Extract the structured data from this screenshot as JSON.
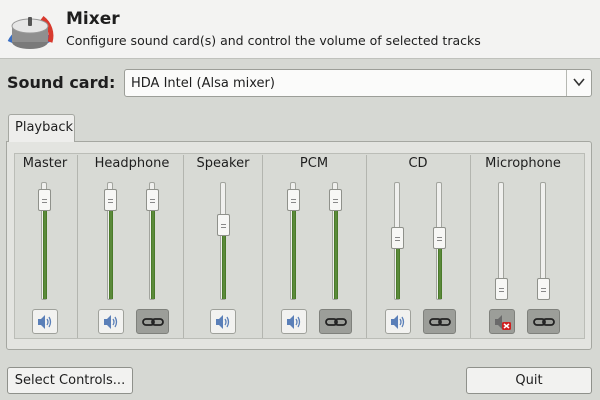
{
  "header": {
    "title": "Mixer",
    "subtitle": "Configure sound card(s) and control the volume of selected tracks"
  },
  "sound_card": {
    "label": "Sound card:",
    "selected": "HDA Intel (Alsa mixer)"
  },
  "tabs": [
    {
      "label": "Playback"
    }
  ],
  "groups": [
    {
      "label": "Master",
      "sliders": [
        0.93
      ],
      "buttons": [
        "speaker-icon"
      ]
    },
    {
      "label": "Headphone",
      "sliders": [
        0.93,
        0.93
      ],
      "buttons": [
        "speaker-icon",
        "link-icon"
      ]
    },
    {
      "label": "Speaker",
      "sliders": [
        0.67
      ],
      "buttons": [
        "speaker-icon"
      ]
    },
    {
      "label": "PCM",
      "sliders": [
        0.93,
        0.93
      ],
      "buttons": [
        "speaker-icon",
        "link-icon"
      ]
    },
    {
      "label": "CD",
      "sliders": [
        0.53,
        0.53
      ],
      "buttons": [
        "speaker-icon",
        "link-icon"
      ]
    },
    {
      "label": "Microphone",
      "sliders": [
        0.0,
        0.0
      ],
      "buttons": [
        "speaker-muted-icon",
        "link-icon"
      ]
    }
  ],
  "footer": {
    "select_controls": "Select Controls...",
    "quit": "Quit"
  },
  "colors": {
    "level_fill": "#5b8a3a",
    "mute_red": "#d02020"
  }
}
